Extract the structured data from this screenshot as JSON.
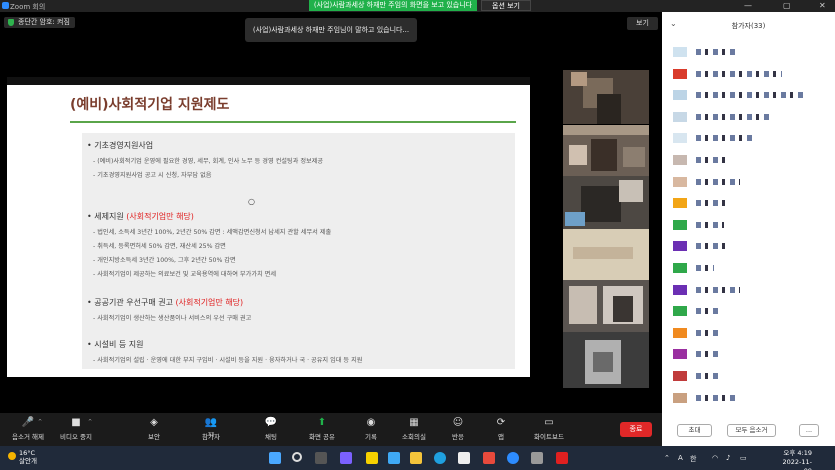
{
  "window": {
    "app_title": "Zoom 회의",
    "share_banner": "(사업)사람과세상 하재만 주임의 화면을 보고 있습니다",
    "view_options": "옵션 보기",
    "controls": [
      "—",
      "▢",
      "✕"
    ]
  },
  "meeting": {
    "encryption_badge": "종단간 암호: 켜짐",
    "viewing_notice": "(사업)사람과세상 하재만 주임님이 말하고 있습니다...",
    "view_button": "보기"
  },
  "slide": {
    "title": "(예비)사회적기업 지원제도",
    "marker": "○",
    "sections": [
      {
        "head": "기초경영지원사업",
        "head_red": "",
        "items": [
          "(예비)사회적기업 운영에 필요한 경영, 세무, 회계, 인사 노무 등 경영 컨설팅과 정보제공",
          "기초경영지원사업 공고 시 신청, 자부담 없음"
        ]
      },
      {
        "head": "세제지원 ",
        "head_red": "(사회적기업만 해당)",
        "items": [
          "법인세, 소득세 3년간 100%, 2년간 50% 감면 : 세액감면신청서 납세지 관할 세무서 제출",
          "취득세, 등록면허세 50% 감면, 재산세 25% 감면",
          "개인지방소득세 3년간 100%, 그후 2년간 50% 감면",
          "사회적기업이 제공하는 의료보건 및 교육용역에 대하여 부가가치 면세"
        ]
      },
      {
        "head": "공공기관 우선구매 권고 ",
        "head_red": "(사회적기업만 해당)",
        "items": [
          "사회적기업이 생산하는 생산품이나 서비스의 우선 구매 권고"
        ]
      },
      {
        "head": "시설비 등 지원",
        "head_red": "",
        "items": [
          "사회적기업의 설립 · 운영에 대한 부지 구입비 · 시설비 등을 지원 · 융자하거나 국 · 공유지 임대 등 지원"
        ]
      }
    ]
  },
  "toolbar": {
    "buttons": [
      {
        "label": "음소거 해제",
        "icon": "microphone-muted-icon"
      },
      {
        "label": "비디오 중지",
        "icon": "video-camera-icon"
      },
      {
        "label": "보안",
        "icon": "shield-icon"
      },
      {
        "label": "참가자",
        "icon": "participants-icon",
        "count": "33"
      },
      {
        "label": "채팅",
        "icon": "chat-icon"
      },
      {
        "label": "화면 공유",
        "icon": "share-screen-icon"
      },
      {
        "label": "기록",
        "icon": "record-icon"
      },
      {
        "label": "소회의실",
        "icon": "breakout-rooms-icon"
      },
      {
        "label": "반응",
        "icon": "reaction-icon"
      },
      {
        "label": "앱",
        "icon": "apps-icon"
      },
      {
        "label": "화이트보드",
        "icon": "whiteboard-icon"
      }
    ],
    "end_button": "종료"
  },
  "participants_panel": {
    "title": "참가자(33)",
    "mute_all": "모두 음소거",
    "invite": "초대",
    "more": "..."
  },
  "taskbar": {
    "temperature": "16°C",
    "weather": "살안개",
    "clock_time": "오후 4:19",
    "clock_date": "2022-11-09",
    "ime": "한",
    "tray_lang": "A"
  },
  "colors": {
    "share_green": "#20b14a",
    "end_red": "#e02828",
    "slide_title": "#7a3d2d",
    "slide_rule": "#5aa54a",
    "slide_highlight_red": "#e02020"
  }
}
